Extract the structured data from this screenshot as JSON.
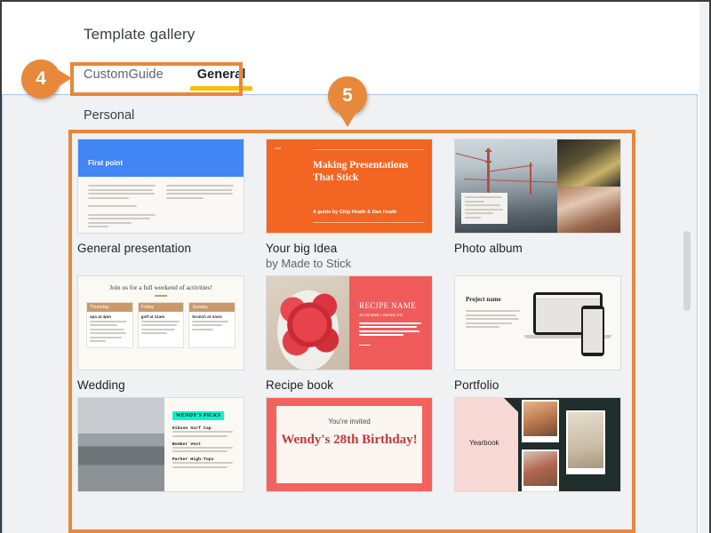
{
  "header": {
    "title": "Template gallery",
    "tabs": [
      {
        "label": "CustomGuide",
        "active": false
      },
      {
        "label": "General",
        "active": true
      }
    ]
  },
  "section": {
    "label": "Personal"
  },
  "scrollbar": {
    "position": "middle"
  },
  "callouts": [
    {
      "number": "4",
      "target": "tab-strip"
    },
    {
      "number": "5",
      "target": "template-grid"
    }
  ],
  "colors": {
    "accent_orange": "#e8883a",
    "tab_underline": "#fbbc04",
    "body_background": "#eff1f3",
    "border_blue": "#a8c7f0"
  },
  "templates": [
    {
      "name": "General presentation",
      "subtitle": "",
      "slide": {
        "heading": "First point",
        "body_left": "Lorem ipsum dolor sit amet consectetur adipiscing elit, sed do eiusmod tempor incididunt ut labore et dolore magna aliqua.",
        "body_left_2": "incididunt ut labore et dolore",
        "body_left_3": "Consectetur adipiscing elit, sed do eiusmod tempor incididunt ut labore et dolore magna aliqua.",
        "body_right": "Lorem ipsum dolor sit amet consectetur adipiscing elit, sed do eiusmod tempor incididunt ut labore et dolore magna aliqua."
      }
    },
    {
      "name": "Your big Idea",
      "subtitle": "by Made to Stick",
      "slide": {
        "heading": "Making Presentations That Stick",
        "byline": "A guide by Chip Heath & Dan Heath"
      }
    },
    {
      "name": "Photo album",
      "subtitle": "",
      "slide": {
        "caption": "Lorem ipsum dolor sit amet, consectetur adipiscing elit, sed do eiusmod tempor incididunt ut labore"
      }
    },
    {
      "name": "Wedding",
      "subtitle": "",
      "slide": {
        "heading": "Join us for a full weekend of activities!",
        "columns": [
          {
            "day": "Thursday",
            "event": "spa at 4pm",
            "text": "Lorem ipsum dolor sit amet, consectetur adipiscing elit, sed do eiusmod tempor incididunt ut labore et dolore magna aliqua."
          },
          {
            "day": "Friday",
            "event": "golf at 11am",
            "text": "Ut enim ad minim veniam, quis nostrud exercitation ullamco laboris nisi ut aliquip ex ea commodo consequat."
          },
          {
            "day": "Sunday",
            "event": "brunch at noon",
            "text": "Lorem ipsum dolor sit amet, consectetur adipiscing elit"
          }
        ]
      }
    },
    {
      "name": "Recipe book",
      "subtitle": "",
      "slide": {
        "heading": "RECIPE NAME",
        "meta": "30 minutes • Serves 4-6",
        "body": "Lorem ipsum dolor sit amet, consectetur adipiscing elit, sed do eiusmod tempor incididunt ut labore et dolore magna aliqua."
      }
    },
    {
      "name": "Portfolio",
      "subtitle": "",
      "slide": {
        "heading": "Project name",
        "body": "Lorem ipsum dolor sit amet, consectetur adipiscing elit, sed do eiusmod tempor incididunt ut labore et dolore magna aliqua."
      }
    },
    {
      "name": "",
      "subtitle": "",
      "slide": {
        "badge": "WENDY'S PICKS",
        "items": [
          {
            "title": "Gibson Surf Cap",
            "text": "Lorem ipsum dolor sit amet, consectetur adipiscing elit"
          },
          {
            "title": "Bomber Vest",
            "text": "Lorem ipsum dolor sit amet, consectetur adipiscing elit"
          },
          {
            "title": "Parker High-Tops",
            "text": "Lorem ipsum dolor sit amet, consectetur adipiscing elit"
          }
        ]
      }
    },
    {
      "name": "",
      "subtitle": "",
      "slide": {
        "invite": "You're invited",
        "heading": "Wendy's 28th Birthday!"
      }
    },
    {
      "name": "",
      "subtitle": "",
      "slide": {
        "heading": "Yearbook"
      }
    }
  ]
}
